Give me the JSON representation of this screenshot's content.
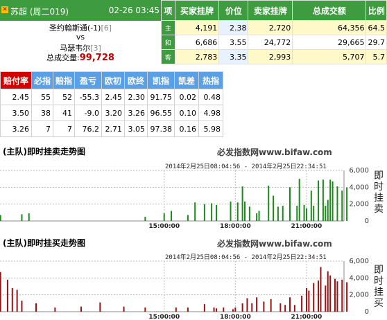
{
  "header": {
    "league": "苏超 (周二019)",
    "datetime": "02-26 03:45"
  },
  "match": {
    "home": "圣约翰斯通(-1)",
    "home_rank": "[6]",
    "vs": "vs",
    "away": "马瑟韦尔",
    "away_rank": "[3]",
    "total_label": "总成交量:",
    "total_value": "99,728"
  },
  "odds_table": {
    "headers": [
      "项",
      "买家挂牌",
      "价位",
      "卖家挂牌",
      "总成交额",
      "比例"
    ],
    "rows": [
      {
        "label": "主",
        "buy": "4,191",
        "price": "2.38",
        "sell": "2,720",
        "total": "64,356",
        "ratio": "64.5"
      },
      {
        "label": "和",
        "buy": "6,686",
        "price": "3.55",
        "sell": "24,772",
        "total": "29,665",
        "ratio": "29.7"
      },
      {
        "label": "客",
        "buy": "2,783",
        "price": "3.35",
        "sell": "2,993",
        "total": "5,707",
        "ratio": "5.7"
      }
    ]
  },
  "index_table": {
    "headers": [
      "赔付率",
      "必指",
      "赔指",
      "盈亏",
      "欧初",
      "欧终",
      "凯指",
      "凯差",
      "热指"
    ],
    "rows": [
      [
        "2.45",
        "55",
        "52",
        "-55.3",
        "2.45",
        "2.30",
        "91.75",
        "0.02",
        "0.48"
      ],
      [
        "3.50",
        "38",
        "41",
        "-9.0",
        "3.20",
        "3.26",
        "96.55",
        "0.10",
        "4.98"
      ],
      [
        "3.26",
        "7",
        "7",
        "76.2",
        "2.71",
        "3.05",
        "97.38",
        "0.16",
        "5.98"
      ]
    ]
  },
  "charts": [
    {
      "title": "(主队)即时挂卖走势图",
      "site": "必发指数网www.bifaw.com",
      "range": "2014年2月25日08:04:56 - 2014年2月25日22:34:51",
      "side_label": "即时挂卖",
      "color": "#1a8a1a"
    },
    {
      "title": "(主队)即时挂买走势图",
      "site": "必发指数网www.bifaw.com",
      "range": "2014年2月25日08:04:56 - 2014年2月25日22:34:51",
      "side_label": "即时挂买",
      "color": "#a01010"
    }
  ],
  "chart_data": [
    {
      "type": "bar",
      "x_ticks": [
        "15:00:00",
        "18:00:00",
        "21:00:00"
      ],
      "y_ticks": [
        "0",
        "2,000",
        "4,000",
        "6,000"
      ],
      "ylim": [
        0,
        6000
      ],
      "values": [
        [
          8.1,
          700
        ],
        [
          9.0,
          800
        ],
        [
          9.3,
          900
        ],
        [
          14.2,
          500
        ],
        [
          15.0,
          900
        ],
        [
          15.3,
          1200
        ],
        [
          16.0,
          700
        ],
        [
          16.3,
          2200
        ],
        [
          16.7,
          2000
        ],
        [
          17.0,
          2100
        ],
        [
          17.2,
          1900
        ],
        [
          17.8,
          2300
        ],
        [
          18.1,
          2200
        ],
        [
          18.3,
          4100
        ],
        [
          18.4,
          2300
        ],
        [
          18.6,
          1700
        ],
        [
          18.9,
          900
        ],
        [
          19.0,
          1200
        ],
        [
          19.4,
          4200
        ],
        [
          19.6,
          3000
        ],
        [
          19.8,
          1700
        ],
        [
          20.0,
          1800
        ],
        [
          20.3,
          4000
        ],
        [
          20.6,
          1800
        ],
        [
          20.7,
          5000
        ],
        [
          20.9,
          1900
        ],
        [
          21.0,
          1500
        ],
        [
          21.2,
          3600
        ],
        [
          21.3,
          1800
        ],
        [
          21.5,
          4800
        ],
        [
          21.7,
          4900
        ],
        [
          21.8,
          1800
        ],
        [
          21.9,
          2500
        ],
        [
          22.0,
          4900
        ],
        [
          22.1,
          4700
        ],
        [
          22.3,
          4100
        ],
        [
          22.5,
          3600
        ],
        [
          22.7,
          4000
        ]
      ]
    },
    {
      "type": "bar",
      "x_ticks": [
        "15:00:00",
        "18:00:00",
        "21:00:00"
      ],
      "y_ticks": [
        "0",
        "2,000",
        "4,000",
        "6,000"
      ],
      "ylim": [
        0,
        6000
      ],
      "values": [
        [
          8.1,
          4700
        ],
        [
          8.4,
          3800
        ],
        [
          8.6,
          2800
        ],
        [
          8.8,
          2600
        ],
        [
          9.0,
          1300
        ],
        [
          9.6,
          1000
        ],
        [
          10.4,
          500
        ],
        [
          11.5,
          600
        ],
        [
          12.3,
          1100
        ],
        [
          13.3,
          600
        ],
        [
          14.2,
          500
        ],
        [
          15.5,
          500
        ],
        [
          16.0,
          500
        ],
        [
          16.7,
          900
        ],
        [
          17.1,
          500
        ],
        [
          17.2,
          400
        ],
        [
          17.5,
          500
        ],
        [
          17.9,
          300
        ],
        [
          18.0,
          500
        ],
        [
          18.3,
          1000
        ],
        [
          18.5,
          1600
        ],
        [
          18.7,
          1000
        ],
        [
          18.9,
          1700
        ],
        [
          19.2,
          1200
        ],
        [
          19.5,
          1500
        ],
        [
          19.9,
          1000
        ],
        [
          20.1,
          800
        ],
        [
          20.3,
          1700
        ],
        [
          20.5,
          800
        ],
        [
          20.8,
          1900
        ],
        [
          21.0,
          2800
        ],
        [
          21.1,
          2500
        ],
        [
          21.3,
          3400
        ],
        [
          21.5,
          3700
        ],
        [
          21.6,
          5300
        ],
        [
          21.8,
          3100
        ],
        [
          21.9,
          4800
        ],
        [
          22.0,
          4300
        ],
        [
          22.2,
          3900
        ],
        [
          22.3,
          3600
        ],
        [
          22.5,
          3800
        ],
        [
          22.7,
          3500
        ]
      ]
    }
  ]
}
